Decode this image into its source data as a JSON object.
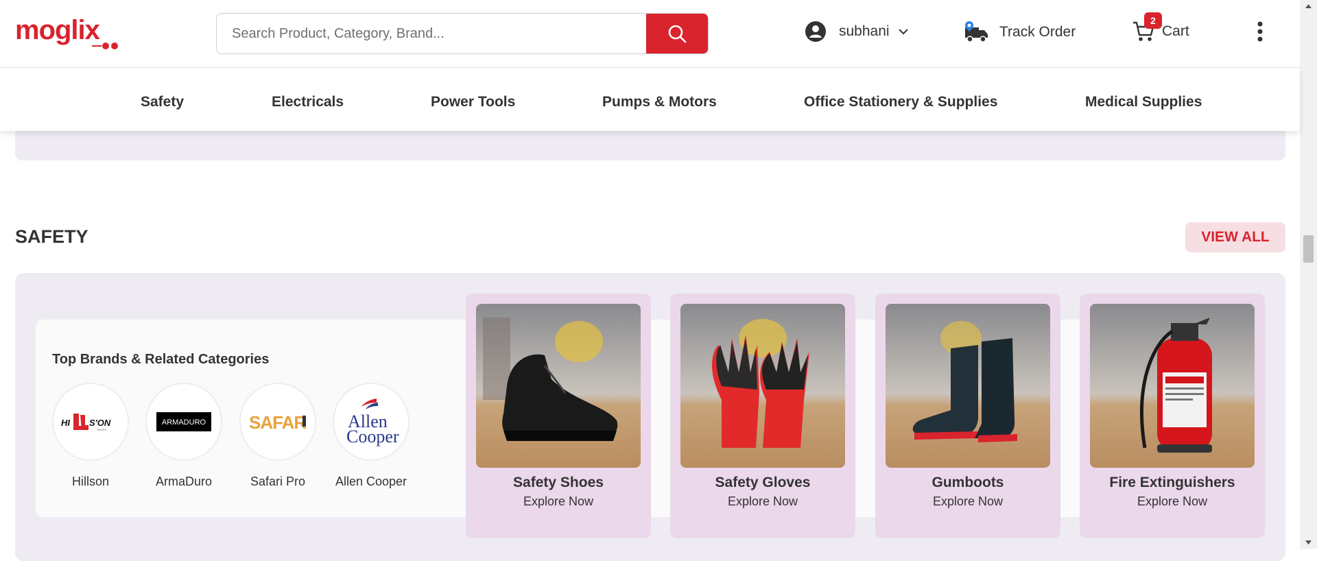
{
  "header": {
    "logo_text": "moglix",
    "search_placeholder": "Search Product, Category, Brand...",
    "user_name": "subhani",
    "track_order": "Track Order",
    "cart_label": "Cart",
    "cart_count": "2"
  },
  "category_nav": [
    "Safety",
    "Electricals",
    "Power Tools",
    "Pumps & Motors",
    "Office Stationery & Supplies",
    "Medical Supplies"
  ],
  "section": {
    "title": "SAFETY",
    "view_all": "VIEW ALL",
    "brands_title": "Top Brands & Related Categories",
    "brands": [
      {
        "name": "Hillson",
        "logo_text": "HILLSON"
      },
      {
        "name": "ArmaDuro",
        "logo_text": "ARMADURO"
      },
      {
        "name": "Safari Pro",
        "logo_text": "SAFARI"
      },
      {
        "name": "Allen Cooper",
        "logo_text": "Allen Cooper"
      }
    ],
    "tiles": [
      {
        "name": "Safety Shoes",
        "cta": "Explore Now"
      },
      {
        "name": "Safety Gloves",
        "cta": "Explore Now"
      },
      {
        "name": "Gumboots",
        "cta": "Explore Now"
      },
      {
        "name": "Fire Extinguishers",
        "cta": "Explore Now"
      }
    ]
  },
  "colors": {
    "brand_red": "#d9232d",
    "tile_bg": "#ebd8ea",
    "section_bg": "#eeecf2"
  }
}
